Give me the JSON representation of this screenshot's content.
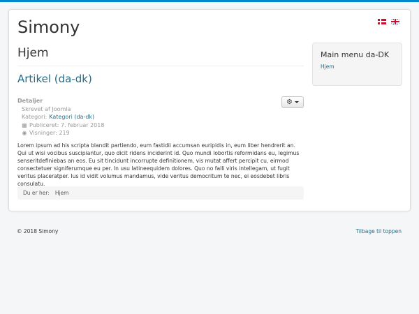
{
  "site": {
    "title": "Simony"
  },
  "page": {
    "heading": "Hjem"
  },
  "article": {
    "title": "Artikel (da-dk)",
    "details_label": "Detaljer",
    "written_by": "Skrevet af Joomla",
    "category_prefix": "Kategori:",
    "category_link": "Kategori (da-dk)",
    "published": "Publiceret: 7. februar 2018",
    "hits": "Visninger: 219",
    "body": "Lorem ipsum ad his scripta blandit partiendo, eum fastidii accumsan euripidis in, eum liber hendrerit an. Qui ut wisi vocibus suscipiantur, quo dicit ridens inciderint id. Quo mundi lobortis reformidans eu, legimus senseritdefiniebas an eos. Eu sit tincidunt incorrupte definitionem, vis mutat affert percipit cu, eirmod consectetuer signiferumque eu per. In usu latineequidem dolores. Quo no falli viris intellegam, ut fugit veritus placeratper. Ius id vidit volumus mandamus, vide veritus democritum te nec, ei eosdebet libris consulatu."
  },
  "breadcrumb": {
    "label": "Du er her:",
    "current": "Hjem"
  },
  "sidebar": {
    "title": "Main menu da-DK",
    "link": "Hjem"
  },
  "footer": {
    "copyright": "© 2018 Simony",
    "back_to_top": "Tilbage til toppen"
  },
  "icons": {
    "tools": "gear-icon",
    "published": "calendar-icon",
    "hits": "eye-icon"
  },
  "colors": {
    "accent": "#0088cc",
    "link": "#1f6f8b"
  }
}
